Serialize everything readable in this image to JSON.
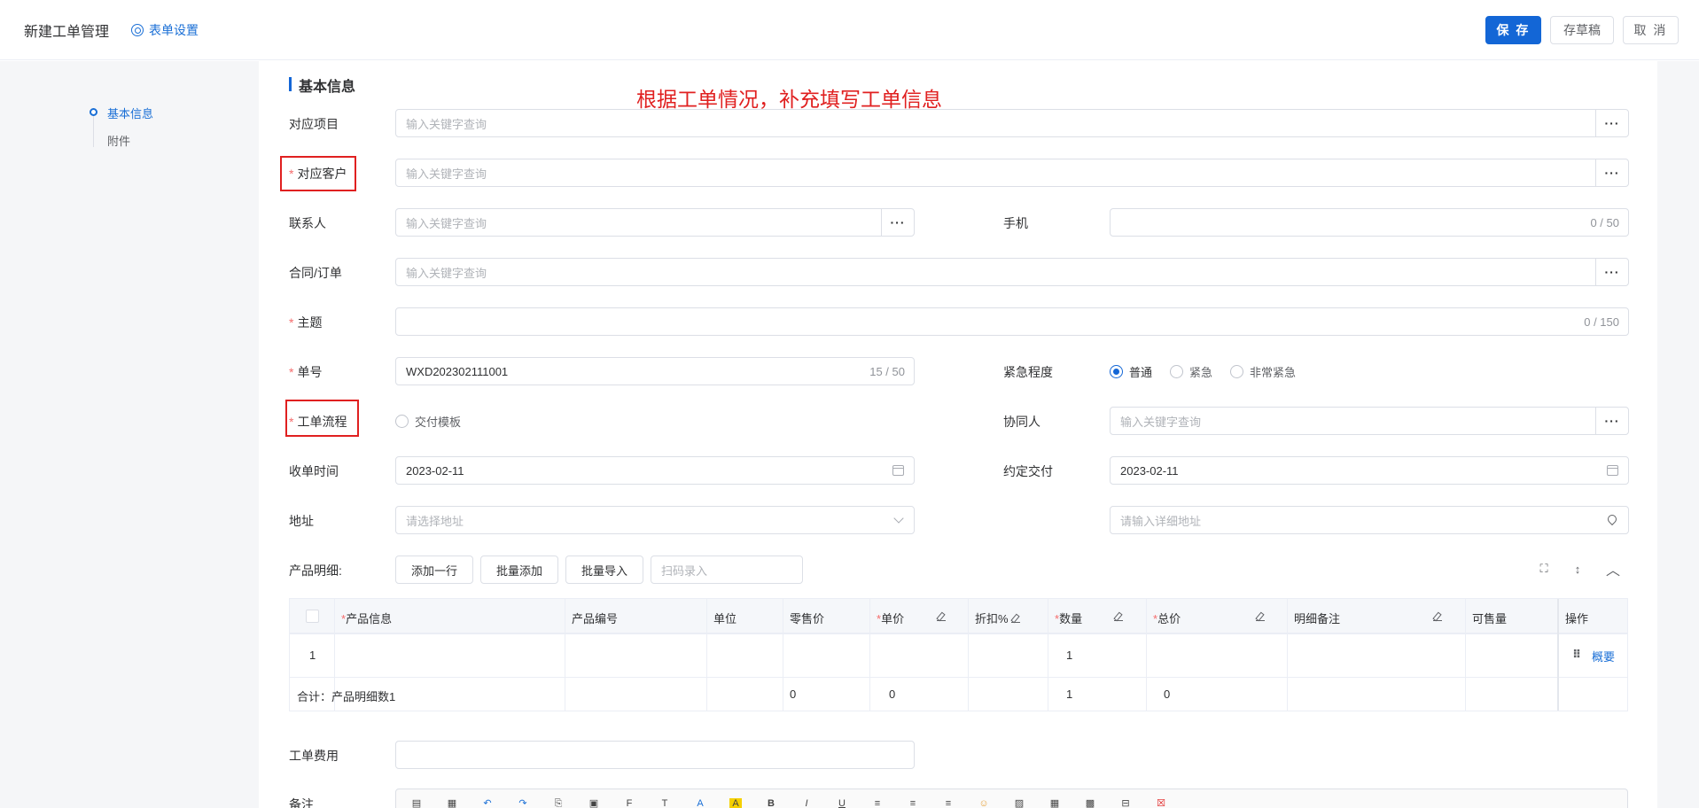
{
  "header": {
    "title": "新建工单管理",
    "settings_label": "表单设置",
    "save_label": "保 存",
    "draft_label": "存草稿",
    "cancel_label": "取 消"
  },
  "anchors": [
    "基本信息",
    "附件"
  ],
  "section_title": "基本信息",
  "annotation": "根据工单情况，补充填写工单信息",
  "fields": {
    "project": {
      "label": "对应项目",
      "placeholder": "输入关键字查询"
    },
    "customer": {
      "label": "对应客户",
      "placeholder": "输入关键字查询"
    },
    "contact": {
      "label": "联系人",
      "placeholder": "输入关键字查询"
    },
    "phone": {
      "label": "手机",
      "count": "0 / 50"
    },
    "contract": {
      "label": "合同/订单",
      "placeholder": "输入关键字查询"
    },
    "subject": {
      "label": "主题",
      "count": "0 / 150"
    },
    "number": {
      "label": "单号",
      "value": "WXD202302111001",
      "count": "15 / 50"
    },
    "urgency": {
      "label": "紧急程度",
      "options": [
        "普通",
        "紧急",
        "非常紧急"
      ],
      "selected": "普通"
    },
    "flow": {
      "label": "工单流程",
      "option": "交付模板"
    },
    "collaborator": {
      "label": "协同人",
      "placeholder": "输入关键字查询"
    },
    "receive_time": {
      "label": "收单时间",
      "value": "2023-02-11"
    },
    "delivery_time": {
      "label": "约定交付",
      "value": "2023-02-11"
    },
    "address": {
      "label": "地址",
      "placeholder": "请选择地址",
      "detail_placeholder": "请输入详细地址"
    },
    "fee": {
      "label": "工单费用"
    },
    "remark": {
      "label": "备注"
    }
  },
  "products": {
    "label": "产品明细:",
    "add_row": "添加一行",
    "batch_add": "批量添加",
    "batch_import": "批量导入",
    "scan_placeholder": "扫码录入",
    "columns": [
      "产品信息",
      "产品编号",
      "单位",
      "零售价",
      "单价",
      "折扣%",
      "数量",
      "总价",
      "明细备注",
      "可售量",
      "操作"
    ],
    "row": {
      "index": "1",
      "quantity": "1",
      "action": "概要"
    },
    "total": {
      "label": "合计：产品明细数1",
      "retail": "0",
      "unit": "0",
      "quantity": "1",
      "total": "0"
    }
  },
  "icons": {
    "gear": "settings-icon",
    "ellipsis": "more-icon",
    "calendar": "calendar-icon",
    "chevron": "chevron-down-icon",
    "location": "location-icon",
    "fullscreen": "fullscreen-icon",
    "sort": "sort-icon",
    "collapse": "chevron-up-icon",
    "drag": "drag-handle-icon"
  },
  "colors": {
    "primary": "#1366d6",
    "required": "#f56c6c",
    "annotation": "#e02020"
  }
}
